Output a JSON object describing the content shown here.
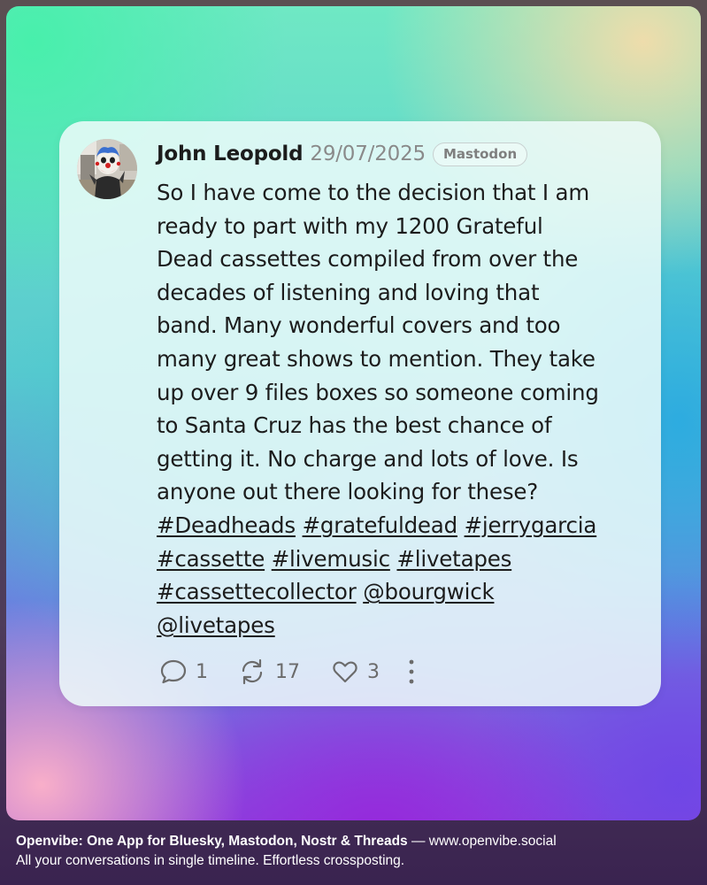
{
  "post": {
    "author": "John Leopold",
    "date": "29/07/2025",
    "network": "Mastodon",
    "text_lines": [
      "So I have come to the decision that I am",
      "ready to part with my 1200 Grateful",
      "Dead cassettes compiled from over the",
      "decades of listening and loving that",
      "band. Many wonderful covers and too",
      "many great shows to mention. They take",
      "up over 9 files boxes so someone coming",
      "to Santa Cruz has the best chance of",
      "getting it. No charge and lots of love. Is",
      "anyone out there looking for these?"
    ],
    "tags": [
      "#Deadheads",
      "#gratefuldead",
      "#jerrygarcia",
      "#cassette",
      "#livemusic",
      "#livetapes",
      "#cassettecollector",
      "@bourgwick",
      "@livetapes"
    ],
    "replies": "1",
    "reposts": "17",
    "likes": "3"
  },
  "footer": {
    "title": "Openvibe: One App for Bluesky, Mastodon, Nostr & Threads",
    "separator": " — ",
    "url": "www.openvibe.social",
    "tagline": "All your conversations in single timeline. Effortless crossposting."
  },
  "icons": {
    "reply": "speech-bubble-icon",
    "repost": "repost-arrows-icon",
    "like": "heart-icon",
    "more": "vertical-ellipsis-icon"
  },
  "colors": {
    "card_background": "#eefcfa",
    "text": "#1c1c1c",
    "muted": "#8a8a8a"
  }
}
